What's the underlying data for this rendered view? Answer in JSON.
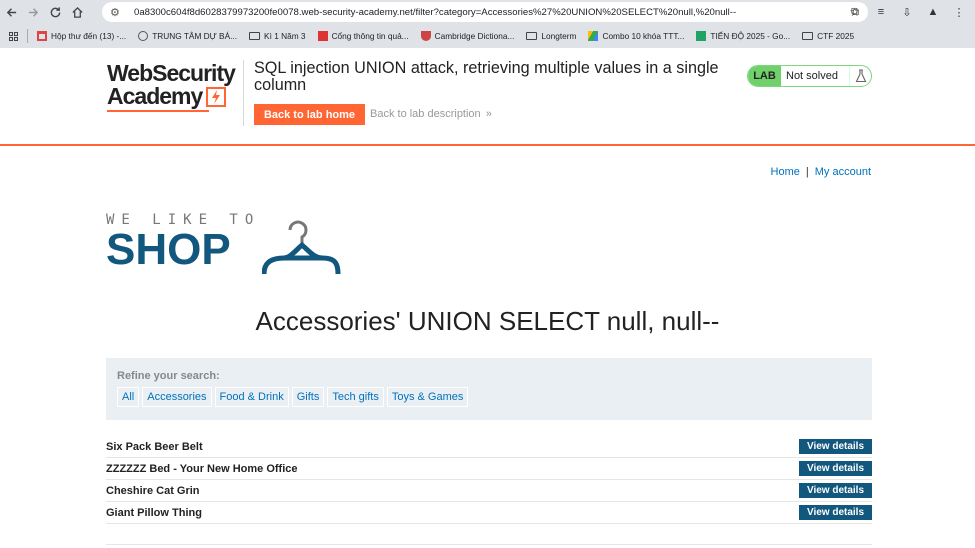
{
  "browser": {
    "url": "0a8300c604f8d6028379973200fe0078.web-security-academy.net/filter?category=Accessories%27%20UNION%20SELECT%20null,%20null--",
    "bookmarks": [
      {
        "label": "Hộp thư đến (13) -...",
        "icon": "gmail-icon"
      },
      {
        "label": "TRUNG TÂM DỰ BÁ...",
        "icon": "globe-icon"
      },
      {
        "label": "Kì 1 Năm 3",
        "icon": "folder-icon"
      },
      {
        "label": "Cổng thông tin quả...",
        "icon": "portal-icon"
      },
      {
        "label": "Cambridge Dictiona...",
        "icon": "cambridge-icon"
      },
      {
        "label": "Longterm",
        "icon": "folder-icon"
      },
      {
        "label": "Combo 10 khóa TTT...",
        "icon": "drive-icon"
      },
      {
        "label": "TIẾN ĐỘ 2025 - Go...",
        "icon": "sheets-icon"
      },
      {
        "label": "CTF 2025",
        "icon": "folder-icon"
      }
    ]
  },
  "lab": {
    "logo_line1": "WebSecurity",
    "logo_line2": "Academy",
    "title": "SQL injection UNION attack, retrieving multiple values in a single column",
    "back_home": "Back to lab home",
    "back_desc": "Back to lab description",
    "status_badge": "LAB",
    "status_text": "Not solved"
  },
  "nav": {
    "home": "Home",
    "sep": "|",
    "account": "My account"
  },
  "shop": {
    "tagline": "WE LIKE TO",
    "name": "SHOP"
  },
  "heading": "Accessories' UNION SELECT null, null--",
  "filters": {
    "label": "Refine your search:",
    "categories": [
      "All",
      "Accessories",
      "Food & Drink",
      "Gifts",
      "Tech gifts",
      "Toys & Games"
    ]
  },
  "products": [
    {
      "name": "Six Pack Beer Belt",
      "button": "View details"
    },
    {
      "name": "ZZZZZZ Bed - Your New Home Office",
      "button": "View details"
    },
    {
      "name": "Cheshire Cat Grin",
      "button": "View details"
    },
    {
      "name": "Giant Pillow Thing",
      "button": "View details"
    }
  ],
  "colors": {
    "accent": "#ff6633",
    "link": "#0071bc",
    "brand": "#12577d",
    "solved_green": "#70d16b"
  }
}
